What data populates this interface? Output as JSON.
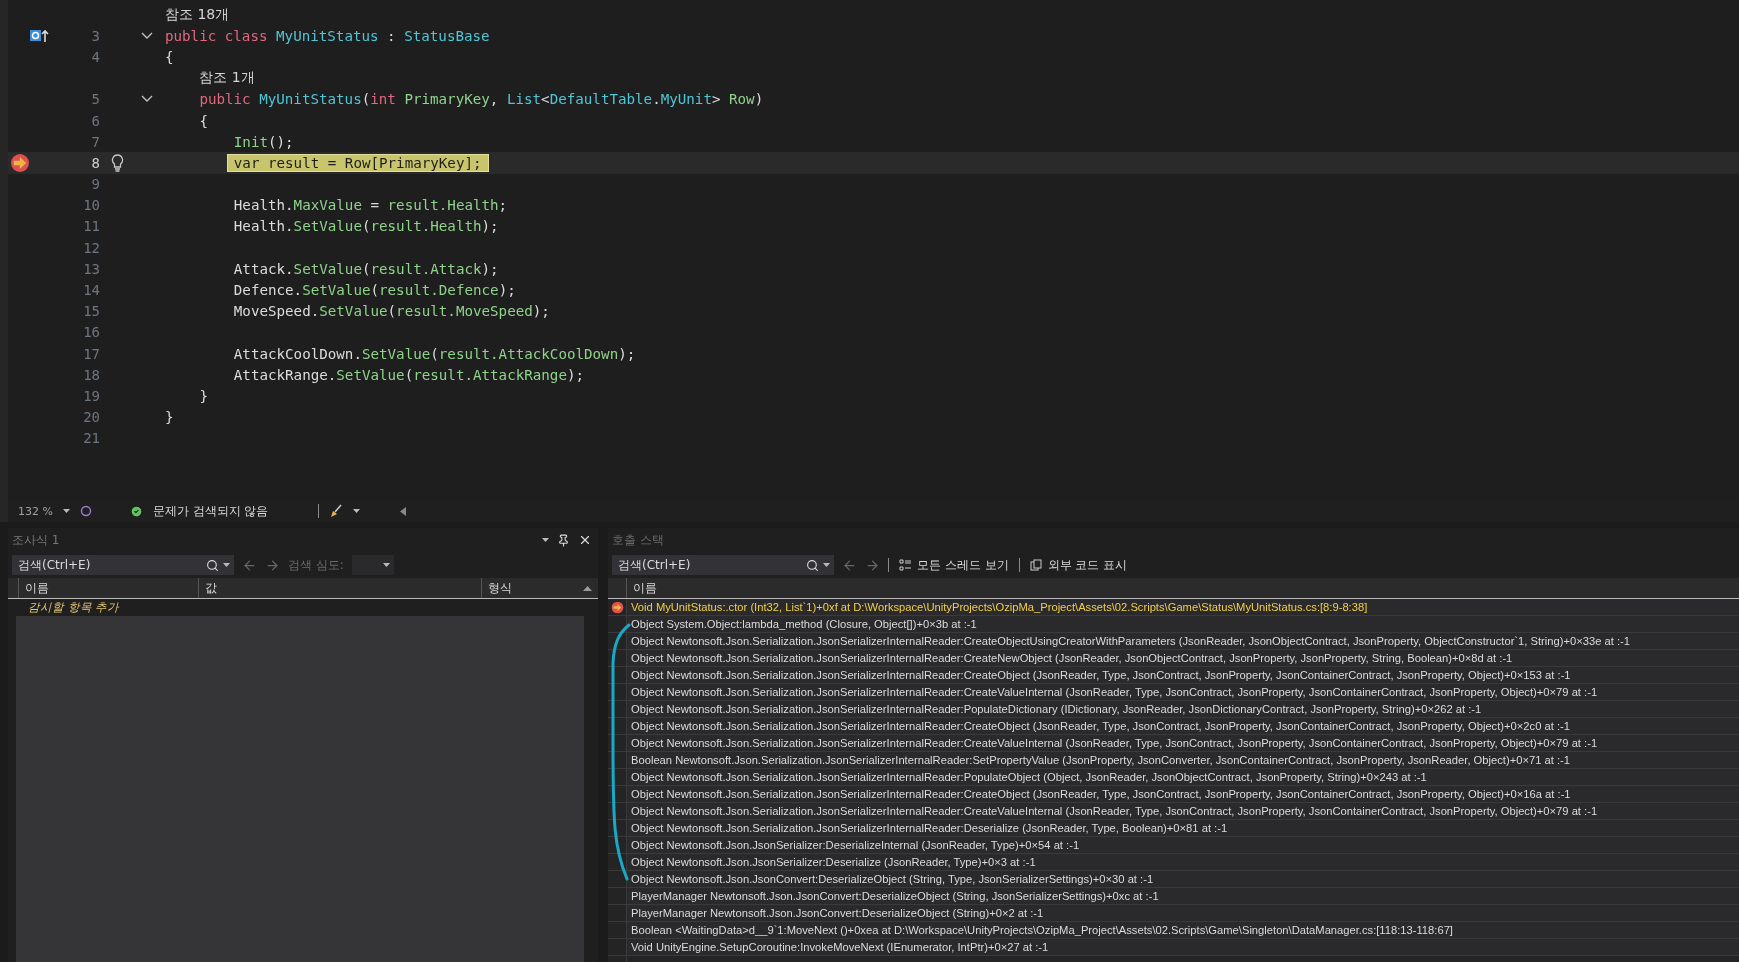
{
  "editor": {
    "lines": [
      {
        "number": "3",
        "lens": "참조 18개",
        "fold": true,
        "current": false,
        "lightbulb": false,
        "overrides": true,
        "tokens": [
          {
            "kind": "kw",
            "text": "public class "
          },
          {
            "kind": "type",
            "text": "MyUnitStatus"
          },
          {
            "kind": "plain",
            "text": " : "
          },
          {
            "kind": "type",
            "text": "StatusBase"
          }
        ]
      },
      {
        "number": "4",
        "fold": false,
        "current": false,
        "lightbulb": false,
        "overrides": false,
        "tokens": [
          {
            "kind": "plain",
            "text": "{"
          }
        ]
      },
      {
        "number": "5",
        "lens": "참조 1개",
        "fold": true,
        "current": false,
        "lightbulb": false,
        "overrides": false,
        "tokens": [
          {
            "kind": "kw",
            "text": "    public "
          },
          {
            "kind": "type",
            "text": "MyUnitStatus"
          },
          {
            "kind": "plain",
            "text": "("
          },
          {
            "kind": "kw",
            "text": "int "
          },
          {
            "kind": "id",
            "text": "PrimaryKey"
          },
          {
            "kind": "plain",
            "text": ", "
          },
          {
            "kind": "type",
            "text": "List"
          },
          {
            "kind": "plain",
            "text": "<"
          },
          {
            "kind": "type",
            "text": "DefaultTable"
          },
          {
            "kind": "plain",
            "text": "."
          },
          {
            "kind": "type",
            "text": "MyUnit"
          },
          {
            "kind": "plain",
            "text": "> "
          },
          {
            "kind": "id",
            "text": "Row"
          },
          {
            "kind": "plain",
            "text": ")"
          }
        ]
      },
      {
        "number": "6",
        "fold": false,
        "current": false,
        "lightbulb": false,
        "overrides": false,
        "tokens": [
          {
            "kind": "plain",
            "text": "    {"
          }
        ]
      },
      {
        "number": "7",
        "fold": false,
        "current": false,
        "lightbulb": false,
        "overrides": false,
        "tokens": [
          {
            "kind": "id",
            "text": "        Init"
          },
          {
            "kind": "plain",
            "text": "();"
          }
        ]
      },
      {
        "number": "8",
        "fold": false,
        "current": true,
        "lightbulb": true,
        "overrides": false,
        "tokens": [
          {
            "kind": "plain",
            "text": "        var result = Row[PrimaryKey];"
          }
        ]
      },
      {
        "number": "9",
        "fold": false,
        "current": false,
        "lightbulb": false,
        "overrides": false
      },
      {
        "number": "10",
        "fold": false,
        "current": false,
        "lightbulb": false,
        "overrides": false,
        "tokens": [
          {
            "kind": "plain",
            "text": "        Health."
          },
          {
            "kind": "id",
            "text": "MaxValue"
          },
          {
            "kind": "plain",
            "text": " = "
          },
          {
            "kind": "id",
            "text": "result.Health"
          },
          {
            "kind": "plain",
            "text": ";"
          }
        ]
      },
      {
        "number": "11",
        "fold": false,
        "current": false,
        "lightbulb": false,
        "overrides": false,
        "tokens": [
          {
            "kind": "plain",
            "text": "        Health."
          },
          {
            "kind": "id",
            "text": "SetValue"
          },
          {
            "kind": "plain",
            "text": "("
          },
          {
            "kind": "id",
            "text": "result.Health"
          },
          {
            "kind": "plain",
            "text": ");"
          }
        ]
      },
      {
        "number": "12",
        "fold": false,
        "current": false,
        "lightbulb": false,
        "overrides": false
      },
      {
        "number": "13",
        "fold": false,
        "current": false,
        "lightbulb": false,
        "overrides": false,
        "tokens": [
          {
            "kind": "plain",
            "text": "        Attack."
          },
          {
            "kind": "id",
            "text": "SetValue"
          },
          {
            "kind": "plain",
            "text": "("
          },
          {
            "kind": "id",
            "text": "result.Attack"
          },
          {
            "kind": "plain",
            "text": ");"
          }
        ]
      },
      {
        "number": "14",
        "fold": false,
        "current": false,
        "lightbulb": false,
        "overrides": false,
        "tokens": [
          {
            "kind": "plain",
            "text": "        Defence."
          },
          {
            "kind": "id",
            "text": "SetValue"
          },
          {
            "kind": "plain",
            "text": "("
          },
          {
            "kind": "id",
            "text": "result.Defence"
          },
          {
            "kind": "plain",
            "text": ");"
          }
        ]
      },
      {
        "number": "15",
        "fold": false,
        "current": false,
        "lightbulb": false,
        "overrides": false,
        "tokens": [
          {
            "kind": "plain",
            "text": "        MoveSpeed."
          },
          {
            "kind": "id",
            "text": "SetValue"
          },
          {
            "kind": "plain",
            "text": "("
          },
          {
            "kind": "id",
            "text": "result.MoveSpeed"
          },
          {
            "kind": "plain",
            "text": ");"
          }
        ]
      },
      {
        "number": "16",
        "fold": false,
        "current": false,
        "lightbulb": false,
        "overrides": false
      },
      {
        "number": "17",
        "fold": false,
        "current": false,
        "lightbulb": false,
        "overrides": false,
        "tokens": [
          {
            "kind": "plain",
            "text": "        AttackCoolDown."
          },
          {
            "kind": "id",
            "text": "SetValue"
          },
          {
            "kind": "plain",
            "text": "("
          },
          {
            "kind": "id",
            "text": "result.AttackCoolDown"
          },
          {
            "kind": "plain",
            "text": ");"
          }
        ]
      },
      {
        "number": "18",
        "fold": false,
        "current": false,
        "lightbulb": false,
        "overrides": false,
        "tokens": [
          {
            "kind": "plain",
            "text": "        AttackRange."
          },
          {
            "kind": "id",
            "text": "SetValue"
          },
          {
            "kind": "plain",
            "text": "("
          },
          {
            "kind": "id",
            "text": "result.AttackRange"
          },
          {
            "kind": "plain",
            "text": ");"
          }
        ]
      },
      {
        "number": "19",
        "fold": false,
        "current": false,
        "lightbulb": false,
        "overrides": false,
        "tokens": [
          {
            "kind": "plain",
            "text": "    }"
          }
        ]
      },
      {
        "number": "20",
        "fold": false,
        "current": false,
        "lightbulb": false,
        "overrides": false,
        "tokens": [
          {
            "kind": "plain",
            "text": "}"
          }
        ]
      },
      {
        "number": "21",
        "fold": false,
        "current": false,
        "lightbulb": false,
        "overrides": false
      }
    ]
  },
  "status_bar": {
    "zoom": "132 %",
    "issues": "문제가 검색되지 않음"
  },
  "watch_panel": {
    "title": "조사식 1",
    "search": {
      "placeholder": "검색(Ctrl+E)"
    },
    "depth_label": "검색 심도:",
    "columns": [
      "이름",
      "값",
      "형식"
    ],
    "add_row": "감시할 항목 추가"
  },
  "call_stack": {
    "title": "호출 스택",
    "search": {
      "placeholder": "검색(Ctrl+E)"
    },
    "buttons": [
      "모든 스레드 보기",
      "외부 코드 표시"
    ],
    "column": "이름",
    "frames": [
      {
        "text": "Void MyUnitStatus:.ctor (Int32, List`1)+0xf at D:\\Workspace\\UnityProjects\\OzipMa_Project\\Assets\\02.Scripts\\Game\\Status\\MyUnitStatus.cs:[8:9-8:38]",
        "current": true
      },
      {
        "text": "Object System.Object:lambda_method (Closure, Object[])+0×3b at :-1",
        "current": false
      },
      {
        "text": "Object Newtonsoft.Json.Serialization.JsonSerializerInternalReader:CreateObjectUsingCreatorWithParameters (JsonReader, JsonObjectContract, JsonProperty, ObjectConstructor`1, String)+0×33e at :-1",
        "current": false
      },
      {
        "text": "Object Newtonsoft.Json.Serialization.JsonSerializerInternalReader:CreateNewObject (JsonReader, JsonObjectContract, JsonProperty, JsonProperty, String, Boolean)+0×8d at :-1",
        "current": false
      },
      {
        "text": "Object Newtonsoft.Json.Serialization.JsonSerializerInternalReader:CreateObject (JsonReader, Type, JsonContract, JsonProperty, JsonContainerContract, JsonProperty, Object)+0×153 at :-1",
        "current": false
      },
      {
        "text": "Object Newtonsoft.Json.Serialization.JsonSerializerInternalReader:CreateValueInternal (JsonReader, Type, JsonContract, JsonProperty, JsonContainerContract, JsonProperty, Object)+0×79 at :-1",
        "current": false
      },
      {
        "text": "Object Newtonsoft.Json.Serialization.JsonSerializerInternalReader:PopulateDictionary (IDictionary, JsonReader, JsonDictionaryContract, JsonProperty, String)+0×262 at :-1",
        "current": false
      },
      {
        "text": "Object Newtonsoft.Json.Serialization.JsonSerializerInternalReader:CreateObject (JsonReader, Type, JsonContract, JsonProperty, JsonContainerContract, JsonProperty, Object)+0×2c0 at :-1",
        "current": false
      },
      {
        "text": "Object Newtonsoft.Json.Serialization.JsonSerializerInternalReader:CreateValueInternal (JsonReader, Type, JsonContract, JsonProperty, JsonContainerContract, JsonProperty, Object)+0×79 at :-1",
        "current": false
      },
      {
        "text": "Boolean Newtonsoft.Json.Serialization.JsonSerializerInternalReader:SetPropertyValue (JsonProperty, JsonConverter, JsonContainerContract, JsonProperty, JsonReader, Object)+0×71 at :-1",
        "current": false
      },
      {
        "text": "Object Newtonsoft.Json.Serialization.JsonSerializerInternalReader:PopulateObject (Object, JsonReader, JsonObjectContract, JsonProperty, String)+0×243 at :-1",
        "current": false
      },
      {
        "text": "Object Newtonsoft.Json.Serialization.JsonSerializerInternalReader:CreateObject (JsonReader, Type, JsonContract, JsonProperty, JsonContainerContract, JsonProperty, Object)+0×16a at :-1",
        "current": false
      },
      {
        "text": "Object Newtonsoft.Json.Serialization.JsonSerializerInternalReader:CreateValueInternal (JsonReader, Type, JsonContract, JsonProperty, JsonContainerContract, JsonProperty, Object)+0×79 at :-1",
        "current": false
      },
      {
        "text": "Object Newtonsoft.Json.Serialization.JsonSerializerInternalReader:Deserialize (JsonReader, Type, Boolean)+0×81 at :-1",
        "current": false
      },
      {
        "text": "Object Newtonsoft.Json.JsonSerializer:DeserializeInternal (JsonReader, Type)+0×54 at :-1",
        "current": false
      },
      {
        "text": "Object Newtonsoft.Json.JsonSerializer:Deserialize (JsonReader, Type)+0×3 at :-1",
        "current": false
      },
      {
        "text": "Object Newtonsoft.Json.JsonConvert:DeserializeObject (String, Type, JsonSerializerSettings)+0×30 at :-1",
        "current": false
      },
      {
        "text": "PlayerManager Newtonsoft.Json.JsonConvert:DeserializeObject (String, JsonSerializerSettings)+0xc at :-1",
        "current": false
      },
      {
        "text": "PlayerManager Newtonsoft.Json.JsonConvert:DeserializeObject (String)+0×2 at :-1",
        "current": false
      },
      {
        "text": "Boolean <WaitingData>d__9`1:MoveNext ()+0xea at D:\\Workspace\\UnityProjects\\OzipMa_Project\\Assets\\02.Scripts\\Game\\Singleton\\DataManager.cs:[118:13-118:67]",
        "current": false
      },
      {
        "text": "Void UnityEngine.SetupCoroutine:InvokeMoveNext (IEnumerator, IntPtr)+0×27 at :-1",
        "current": false
      }
    ]
  }
}
